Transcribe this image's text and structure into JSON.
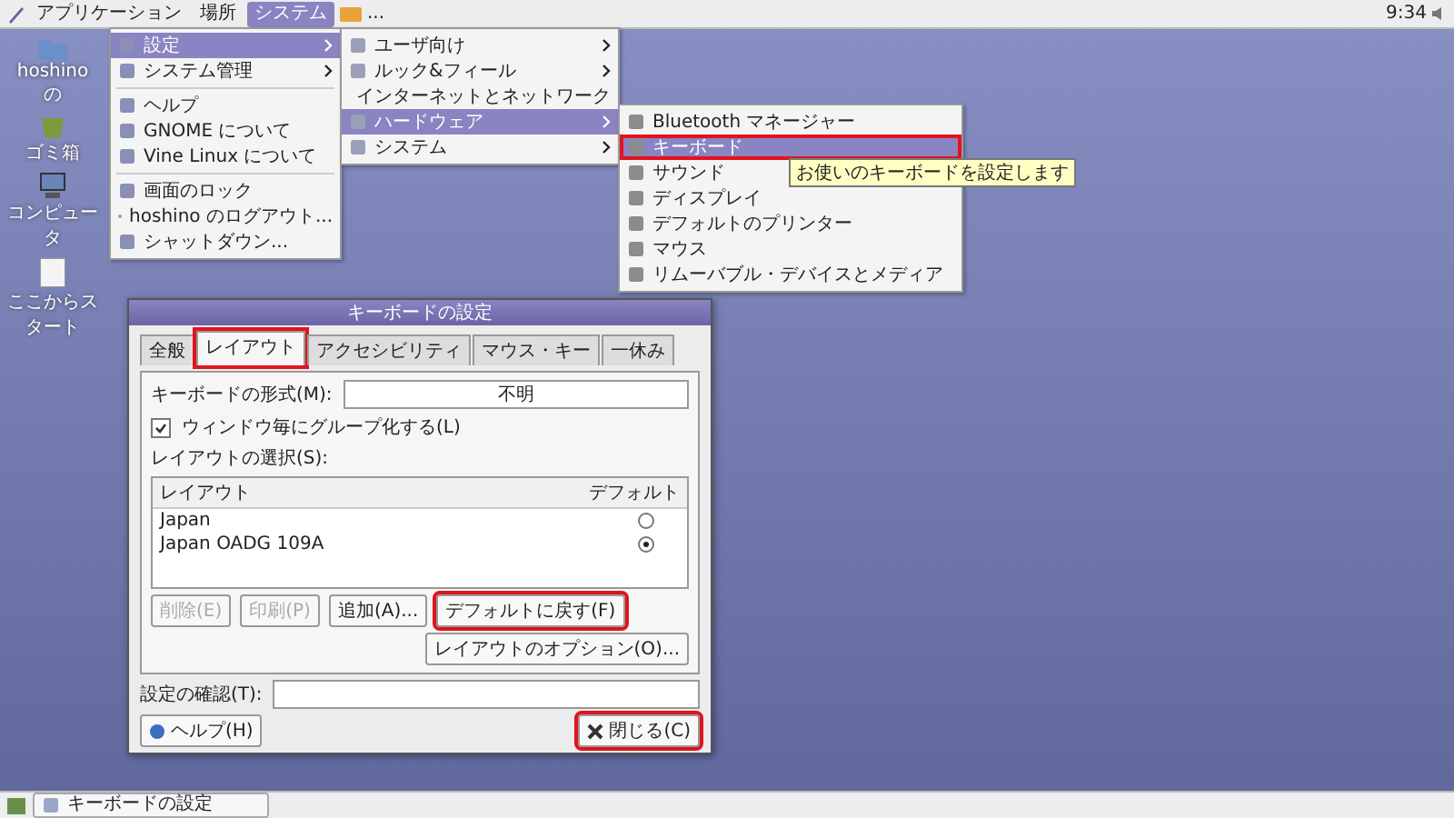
{
  "top_panel": {
    "menus": [
      {
        "label": "アプリケーション",
        "selected": false
      },
      {
        "label": "場所",
        "selected": false
      },
      {
        "label": "システム",
        "selected": true
      }
    ],
    "more": "...",
    "clock": "9:34"
  },
  "desktop_icons": [
    {
      "label": "hoshino の",
      "kind": "home"
    },
    {
      "label": "ゴミ箱",
      "kind": "trash"
    },
    {
      "label": "コンピュータ",
      "kind": "computer"
    },
    {
      "label": "ここからスタート",
      "kind": "file"
    }
  ],
  "system_menu": {
    "groups": [
      [
        {
          "label": "設定",
          "submenu": true,
          "selected": true
        },
        {
          "label": "システム管理",
          "submenu": true,
          "selected": false
        }
      ],
      [
        {
          "label": "ヘルプ",
          "submenu": false,
          "selected": false
        },
        {
          "label": "GNOME について",
          "submenu": false,
          "selected": false
        },
        {
          "label": "Vine Linux について",
          "submenu": false,
          "selected": false
        }
      ],
      [
        {
          "label": "画面のロック",
          "submenu": false,
          "selected": false
        },
        {
          "label": "hoshino のログアウト...",
          "submenu": false,
          "selected": false
        },
        {
          "label": "シャットダウン...",
          "submenu": false,
          "selected": false
        }
      ]
    ]
  },
  "settings_menu": {
    "items": [
      {
        "label": "ユーザ向け",
        "selected": false
      },
      {
        "label": "ルック&フィール",
        "selected": false
      },
      {
        "label": "インターネットとネットワーク",
        "selected": false
      },
      {
        "label": "ハードウェア",
        "selected": true
      },
      {
        "label": "システム",
        "selected": false
      }
    ]
  },
  "hardware_menu": {
    "items": [
      {
        "label": "Bluetooth マネージャー",
        "selected": false,
        "highlighted": false
      },
      {
        "label": "キーボード",
        "selected": true,
        "highlighted": true
      },
      {
        "label": "サウンド",
        "selected": false,
        "highlighted": false
      },
      {
        "label": "ディスプレイ",
        "selected": false,
        "highlighted": false
      },
      {
        "label": "デフォルトのプリンター",
        "selected": false,
        "highlighted": false
      },
      {
        "label": "マウス",
        "selected": false,
        "highlighted": false
      },
      {
        "label": "リムーバブル・デバイスとメディア",
        "selected": false,
        "highlighted": false
      }
    ]
  },
  "tooltip": "お使いのキーボードを設定します",
  "dialog": {
    "title": "キーボードの設定",
    "tabs": [
      {
        "label": "全般",
        "selected": false,
        "highlighted": false
      },
      {
        "label": "レイアウト",
        "selected": true,
        "highlighted": true
      },
      {
        "label": "アクセシビリティ",
        "selected": false,
        "highlighted": false
      },
      {
        "label": "マウス・キー",
        "selected": false,
        "highlighted": false
      },
      {
        "label": "一休み",
        "selected": false,
        "highlighted": false
      }
    ],
    "model_label": "キーボードの形式(M):",
    "model_value": "不明",
    "group_checkbox": {
      "label": "ウィンドウ毎にグループ化する(L)",
      "checked": true
    },
    "layouts_label": "レイアウトの選択(S):",
    "layout_columns": [
      "レイアウト",
      "デフォルト"
    ],
    "layouts": [
      {
        "name": "Japan",
        "default": false
      },
      {
        "name": "Japan OADG 109A",
        "default": true
      }
    ],
    "buttons": [
      {
        "label": "削除(E)",
        "disabled": true,
        "highlighted": false
      },
      {
        "label": "印刷(P)",
        "disabled": true,
        "highlighted": false
      },
      {
        "label": "追加(A)...",
        "disabled": false,
        "highlighted": false
      },
      {
        "label": "デフォルトに戻す(F)",
        "disabled": false,
        "highlighted": true
      }
    ],
    "options_button": "レイアウトのオプション(O)...",
    "test_label": "設定の確認(T):",
    "help_button": {
      "label": "ヘルプ(H)",
      "highlighted": false
    },
    "close_button": {
      "label": "閉じる(C)",
      "highlighted": true
    }
  },
  "bottom_panel": {
    "tasks": [
      {
        "label": "キーボードの設定",
        "selected": false
      }
    ]
  }
}
